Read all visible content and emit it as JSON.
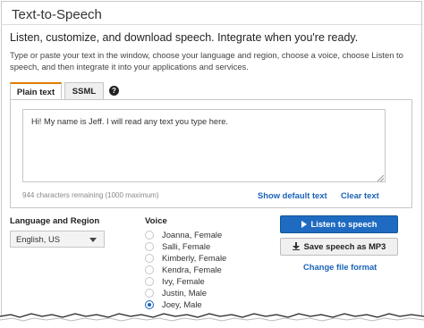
{
  "header": {
    "title": "Text-to-Speech",
    "subtitle": "Listen, customize, and download speech. Integrate when you're ready.",
    "description": "Type or paste your text in the window, choose your language and region, choose a voice, choose Listen to speech, and then integrate it into your applications and services."
  },
  "tabs": [
    {
      "label": "Plain text",
      "active": true
    },
    {
      "label": "SSML",
      "active": false
    }
  ],
  "help_icon": "help-icon",
  "editor": {
    "value": "Hi! My name is Jeff. I will read any text you type here.",
    "chars_remaining": "944 characters remaining (1000 maximum)",
    "show_default_label": "Show default text",
    "clear_label": "Clear text"
  },
  "language": {
    "label": "Language and Region",
    "selected": "English, US"
  },
  "voice": {
    "label": "Voice",
    "options": [
      {
        "label": "Joanna, Female",
        "selected": false
      },
      {
        "label": "Salli, Female",
        "selected": false
      },
      {
        "label": "Kimberly, Female",
        "selected": false
      },
      {
        "label": "Kendra, Female",
        "selected": false
      },
      {
        "label": "Ivy, Female",
        "selected": false
      },
      {
        "label": "Justin, Male",
        "selected": false
      },
      {
        "label": "Joey, Male",
        "selected": true
      }
    ]
  },
  "actions": {
    "listen_label": "Listen to speech",
    "save_label": "Save speech as MP3",
    "change_format_label": "Change file format"
  },
  "colors": {
    "primary_button": "#1f6bc2",
    "link": "#1a64b8",
    "active_tab_accent": "#e07b00"
  }
}
